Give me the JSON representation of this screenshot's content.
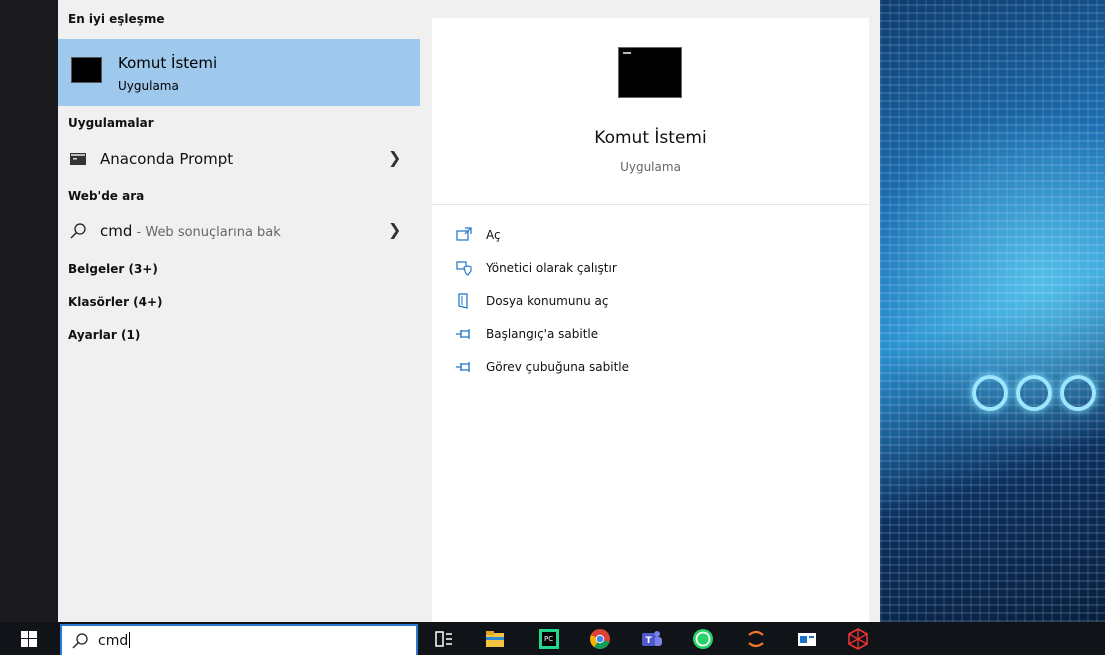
{
  "results": {
    "best_match_header": "En iyi eşleşme",
    "best_match": {
      "title": "Komut İstemi",
      "subtitle": "Uygulama"
    },
    "apps_header": "Uygulamalar",
    "apps": [
      {
        "label": "Anaconda Prompt",
        "icon": "terminal-icon"
      }
    ],
    "web_header": "Web'de ara",
    "web_result": {
      "query": "cmd",
      "suffix": " - Web sonuçlarına bak"
    },
    "documents": "Belgeler (3+)",
    "folders": "Klasörler (4+)",
    "settings": "Ayarlar (1)"
  },
  "preview": {
    "title": "Komut İstemi",
    "subtitle": "Uygulama",
    "actions": [
      {
        "label": "Aç",
        "icon": "open-icon"
      },
      {
        "label": "Yönetici olarak çalıştır",
        "icon": "run-as-admin-icon"
      },
      {
        "label": "Dosya konumunu aç",
        "icon": "file-location-icon"
      },
      {
        "label": "Başlangıç'a sabitle",
        "icon": "pin-icon"
      },
      {
        "label": "Görev çubuğuna sabitle",
        "icon": "pin-icon"
      }
    ]
  },
  "taskbar": {
    "search_value": "cmd",
    "apps": [
      "task-view-icon",
      "file-explorer-icon",
      "pycharm-icon",
      "chrome-icon",
      "teams-icon",
      "whatsapp-icon",
      "jupyter-icon",
      "app-window-icon",
      "network-app-icon"
    ]
  },
  "colors": {
    "accent": "#0078d7",
    "selection": "#9ec8ec",
    "taskbar": "#101317"
  }
}
